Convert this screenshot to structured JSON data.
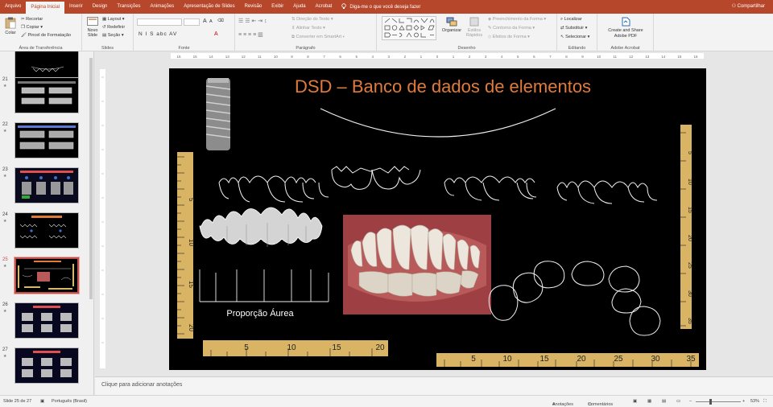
{
  "tabs": [
    {
      "label": "Arquivo",
      "active": false
    },
    {
      "label": "Página Inicial",
      "active": true
    },
    {
      "label": "Inserir",
      "active": false
    },
    {
      "label": "Design",
      "active": false
    },
    {
      "label": "Transições",
      "active": false
    },
    {
      "label": "Animações",
      "active": false
    },
    {
      "label": "Apresentação de Slides",
      "active": false
    },
    {
      "label": "Revisão",
      "active": false
    },
    {
      "label": "Exibir",
      "active": false
    },
    {
      "label": "Ajuda",
      "active": false
    },
    {
      "label": "Acrobat",
      "active": false
    }
  ],
  "tell_me": "Diga-me o que você deseja fazer",
  "share": "Compartilhar",
  "ribbon": {
    "clipboard": {
      "paste": "Colar",
      "cut": "Recortar",
      "copy": "Copiar",
      "format_painter": "Pincel de Formatação",
      "label": "Área de Transferência"
    },
    "slides": {
      "new_slide": "Novo Slide",
      "layout": "Layout",
      "reset": "Redefinir",
      "section": "Seção",
      "label": "Slides"
    },
    "font": {
      "label": "Fonte",
      "buttons": "N  I  S  abc  AV",
      "size_up": "A",
      "size_down": "A"
    },
    "paragraph": {
      "text_direction": "Direção do Texto",
      "align_text": "Alinhar Texto",
      "smartart": "Converter em SmartArt",
      "label": "Parágrafo"
    },
    "drawing": {
      "arrange": "Organizar",
      "quick_styles": "Estilos Rápidos",
      "fill": "Preenchimento da Forma",
      "outline": "Contorno da Forma",
      "effects": "Efeitos de Forma",
      "label": "Desenho"
    },
    "editing": {
      "find": "Localizar",
      "replace": "Substituir",
      "select": "Selecionar",
      "label": "Editando"
    },
    "acrobat": {
      "create": "Create and Share Adobe PDF",
      "label": "Adobe Acrobat"
    }
  },
  "thumbnails": [
    {
      "num": "",
      "star": ""
    },
    {
      "num": "21",
      "star": "★"
    },
    {
      "num": "22",
      "star": "★"
    },
    {
      "num": "23",
      "star": "★"
    },
    {
      "num": "24",
      "star": "★"
    },
    {
      "num": "25",
      "star": "★"
    },
    {
      "num": "26",
      "star": "★"
    },
    {
      "num": "27",
      "star": "★"
    }
  ],
  "selected_slide": "25",
  "ruler_ticks": [
    "16",
    "15",
    "14",
    "13",
    "12",
    "11",
    "10",
    "9",
    "8",
    "7",
    "6",
    "5",
    "4",
    "3",
    "2",
    "1",
    "0",
    "1",
    "2",
    "3",
    "4",
    "5",
    "6",
    "7",
    "8",
    "9",
    "10",
    "11",
    "12",
    "13",
    "14",
    "15",
    "16"
  ],
  "slide": {
    "title": "DSD – Banco de dados de elementos",
    "caption": "Proporção Áurea",
    "ruler_left_labels": [
      "5",
      "10",
      "15",
      "20"
    ],
    "ruler_bottom_left_labels": [
      "5",
      "10",
      "15",
      "20"
    ],
    "ruler_right_labels": [
      "5",
      "10",
      "15",
      "20",
      "25",
      "30",
      "35"
    ],
    "ruler_bottom_right_labels": [
      "5",
      "10",
      "15",
      "20",
      "25",
      "30",
      "35"
    ],
    "title_color": "#e07b39"
  },
  "notes_placeholder": "Clique para adicionar anotações",
  "status": {
    "slide_count": "Slide 25 de 27",
    "language": "Português (Brasil)",
    "notes": "Anotações",
    "comments": "Comentários",
    "zoom": "53%"
  }
}
